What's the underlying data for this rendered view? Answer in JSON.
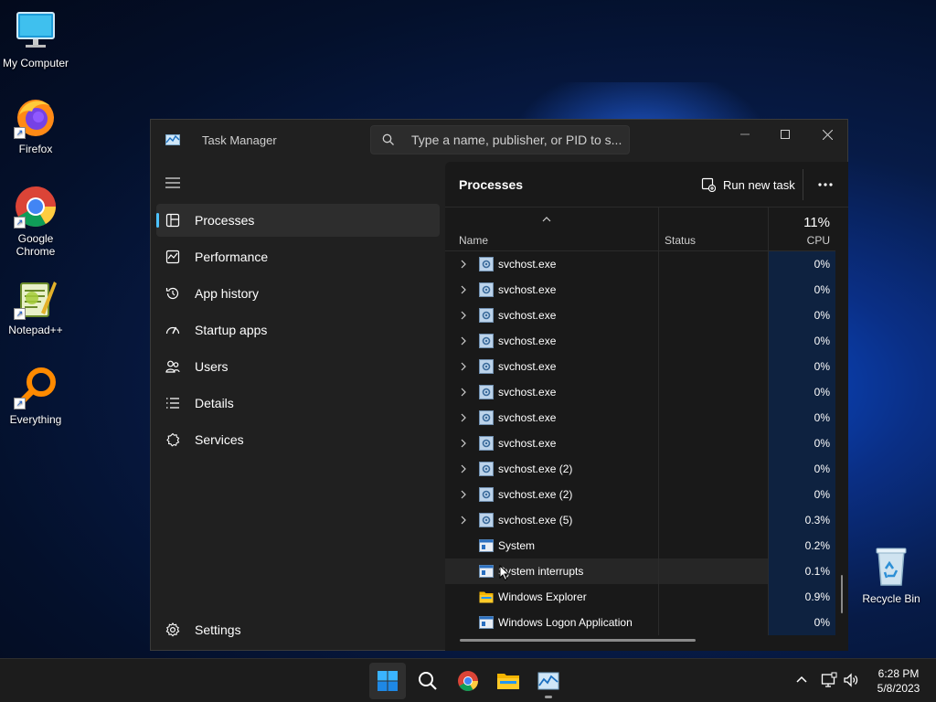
{
  "desktop": {
    "icons": [
      {
        "label": "My Computer",
        "icon": "monitor-icon"
      },
      {
        "label": "Firefox",
        "icon": "firefox-icon"
      },
      {
        "label": "Google\nChrome",
        "icon": "chrome-icon"
      },
      {
        "label": "Notepad++",
        "icon": "notepadpp-icon"
      },
      {
        "label": "Everything",
        "icon": "everything-icon"
      },
      {
        "label": "Recycle Bin",
        "icon": "recycle-bin-icon"
      }
    ]
  },
  "window": {
    "title": "Task Manager",
    "search_placeholder": "Type a name, publisher, or PID to s..."
  },
  "sidebar": {
    "items": [
      {
        "label": "Processes",
        "icon": "processes-icon",
        "active": true
      },
      {
        "label": "Performance",
        "icon": "performance-icon"
      },
      {
        "label": "App history",
        "icon": "history-icon"
      },
      {
        "label": "Startup apps",
        "icon": "startup-icon"
      },
      {
        "label": "Users",
        "icon": "users-icon"
      },
      {
        "label": "Details",
        "icon": "details-icon"
      },
      {
        "label": "Services",
        "icon": "services-icon"
      }
    ],
    "settings_label": "Settings"
  },
  "main": {
    "title": "Processes",
    "run_new_task": "Run new task",
    "columns": {
      "name": "Name",
      "status": "Status",
      "cpu": "CPU",
      "cpu_total": "11%"
    },
    "rows": [
      {
        "name": "svchost.exe",
        "status": "",
        "cpu": "0%",
        "expandable": true,
        "icon": "gear"
      },
      {
        "name": "svchost.exe",
        "status": "",
        "cpu": "0%",
        "expandable": true,
        "icon": "gear"
      },
      {
        "name": "svchost.exe",
        "status": "",
        "cpu": "0%",
        "expandable": true,
        "icon": "gear"
      },
      {
        "name": "svchost.exe",
        "status": "",
        "cpu": "0%",
        "expandable": true,
        "icon": "gear"
      },
      {
        "name": "svchost.exe",
        "status": "",
        "cpu": "0%",
        "expandable": true,
        "icon": "gear"
      },
      {
        "name": "svchost.exe",
        "status": "",
        "cpu": "0%",
        "expandable": true,
        "icon": "gear"
      },
      {
        "name": "svchost.exe",
        "status": "",
        "cpu": "0%",
        "expandable": true,
        "icon": "gear"
      },
      {
        "name": "svchost.exe",
        "status": "",
        "cpu": "0%",
        "expandable": true,
        "icon": "gear"
      },
      {
        "name": "svchost.exe (2)",
        "status": "",
        "cpu": "0%",
        "expandable": true,
        "icon": "gear"
      },
      {
        "name": "svchost.exe (2)",
        "status": "",
        "cpu": "0%",
        "expandable": true,
        "icon": "gear"
      },
      {
        "name": "svchost.exe (5)",
        "status": "",
        "cpu": "0.3%",
        "expandable": true,
        "icon": "gear"
      },
      {
        "name": "System",
        "status": "",
        "cpu": "0.2%",
        "expandable": false,
        "icon": "window"
      },
      {
        "name": "System interrupts",
        "status": "",
        "cpu": "0.1%",
        "expandable": false,
        "icon": "window",
        "hover": true
      },
      {
        "name": "Windows Explorer",
        "status": "",
        "cpu": "0.9%",
        "expandable": false,
        "icon": "folder"
      },
      {
        "name": "Windows Logon Application",
        "status": "",
        "cpu": "0%",
        "expandable": false,
        "icon": "window"
      }
    ]
  },
  "taskbar": {
    "apps": [
      "start-icon",
      "search-icon",
      "chrome-icon",
      "file-explorer-icon",
      "task-manager-icon"
    ],
    "time": "6:28 PM",
    "date": "5/8/2023"
  },
  "colors": {
    "accent": "#4cc2ff",
    "cpu_cell": "#0e2240",
    "window_bg": "#202020",
    "panel_bg": "#191919"
  }
}
